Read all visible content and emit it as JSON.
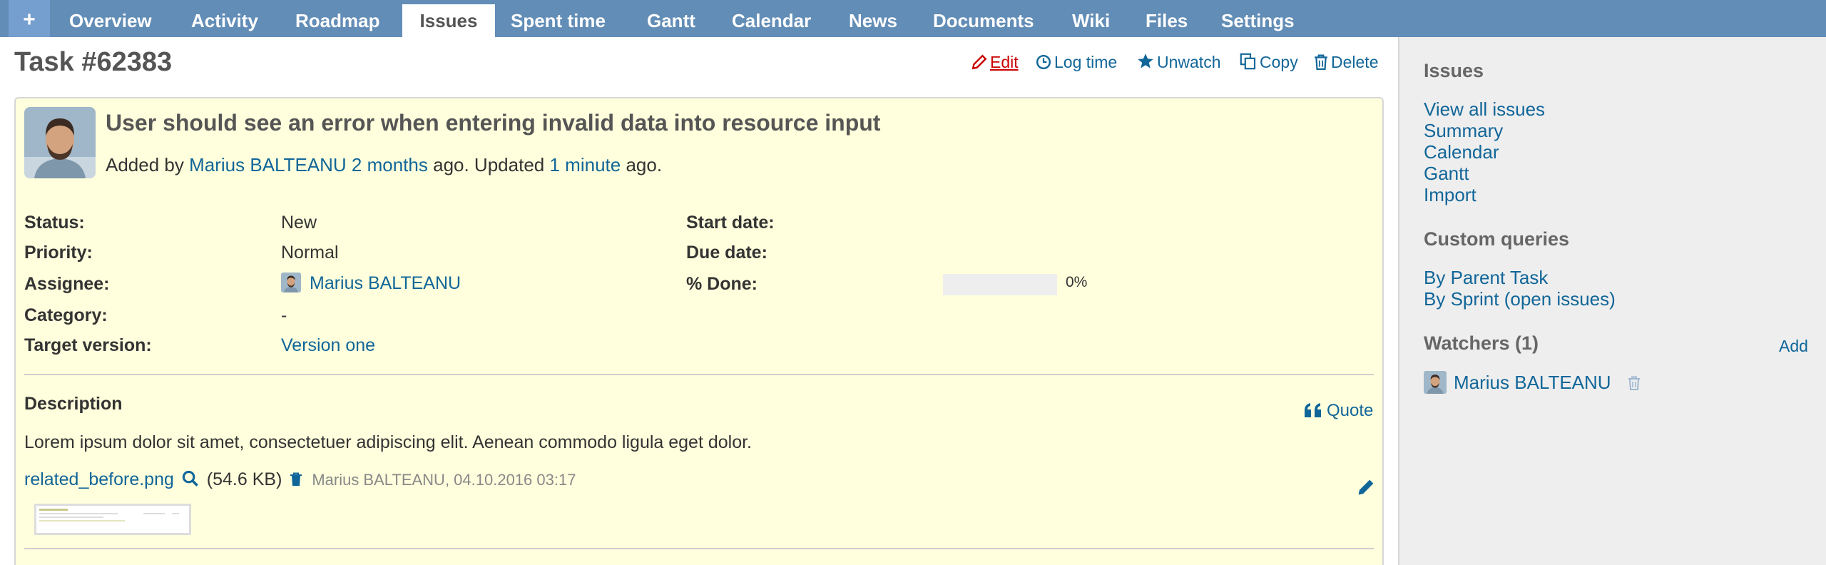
{
  "menu": {
    "plus": "+",
    "tabs": [
      "Overview",
      "Activity",
      "Roadmap",
      "Issues",
      "Spent time",
      "Gantt",
      "Calendar",
      "News",
      "Documents",
      "Wiki",
      "Files",
      "Settings"
    ]
  },
  "issue": {
    "title": "Task #62383",
    "subject": "User should see an error when entering invalid data into resource input",
    "added_by_prefix": "Added by",
    "author": "Marius BALTEANU",
    "created_ago": "2 months",
    "ago_updated": "ago. Updated",
    "updated_ago": "1 minute",
    "ago_end": "ago.",
    "contextual": {
      "edit": "Edit",
      "log_time": "Log time",
      "unwatch": "Unwatch",
      "copy": "Copy",
      "delete": "Delete"
    },
    "attributes": {
      "status_label": "Status:",
      "status": "New",
      "priority_label": "Priority:",
      "priority": "Normal",
      "assignee_label": "Assignee:",
      "assignee": "Marius BALTEANU",
      "category_label": "Category:",
      "category": "-",
      "target_version_label": "Target version:",
      "target_version": "Version one",
      "start_date_label": "Start date:",
      "due_date_label": "Due date:",
      "done_label": "% Done:",
      "done_ratio": 0,
      "done_text": "0%"
    },
    "description": {
      "heading": "Description",
      "quote": "Quote",
      "text": "Lorem ipsum dolor sit amet, consectetuer adipiscing elit. Aenean commodo ligula eget dolor."
    },
    "attachment": {
      "filename": "related_before.png",
      "size": "(54.6 KB)",
      "meta": "Marius BALTEANU, 04.10.2016 03:17"
    }
  },
  "sidebar": {
    "issues_heading": "Issues",
    "issue_links": [
      "View all issues",
      "Summary",
      "Calendar",
      "Gantt",
      "Import"
    ],
    "queries_heading": "Custom queries",
    "query_links": [
      "By Parent Task",
      "By Sprint (open issues)"
    ],
    "watchers_heading": "Watchers (1)",
    "watchers_add": "Add",
    "watcher": "Marius BALTEANU"
  },
  "colors": {
    "menu_bg": "#628db6",
    "link": "#116699",
    "issue_bg": "#ffffdd",
    "sidebar_bg": "#eeeeee",
    "edit": "#cc0000"
  }
}
